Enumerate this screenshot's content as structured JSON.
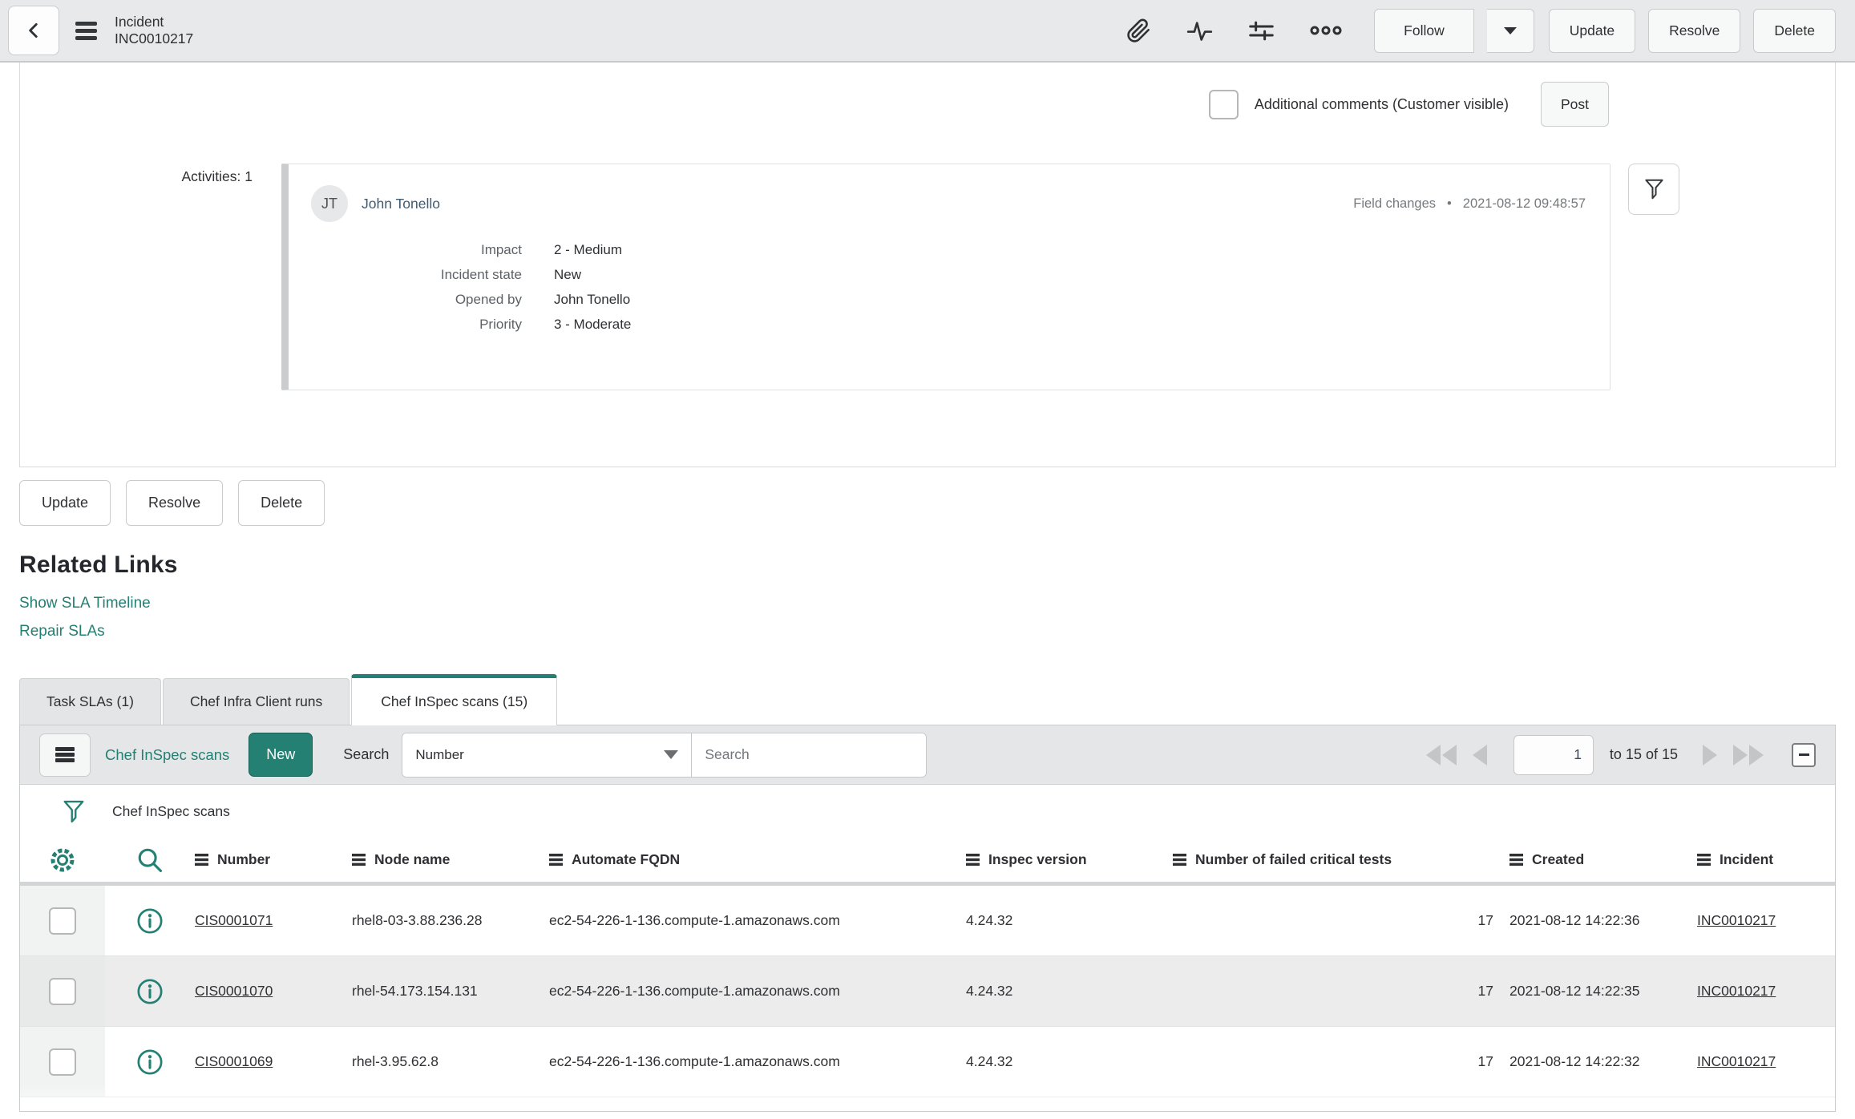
{
  "colors": {
    "accent": "#238073",
    "header_bg": "#e8e9eb",
    "stripe_row": "#ececed"
  },
  "header": {
    "title_line1": "Incident",
    "title_line2": "INC0010217",
    "follow": "Follow",
    "update": "Update",
    "resolve": "Resolve",
    "delete": "Delete"
  },
  "comments": {
    "label": "Additional comments (Customer visible)",
    "post": "Post"
  },
  "activities": {
    "count_label": "Activities: 1",
    "entry": {
      "avatar": "JT",
      "user": "John Tonello",
      "meta_type": "Field changes",
      "meta_separator": "•",
      "meta_time": "2021-08-12 09:48:57",
      "fields": [
        {
          "label": "Impact",
          "value": "2 - Medium"
        },
        {
          "label": "Incident state",
          "value": "New"
        },
        {
          "label": "Opened by",
          "value": "John Tonello"
        },
        {
          "label": "Priority",
          "value": "3 - Moderate"
        }
      ]
    }
  },
  "form_actions": {
    "update": "Update",
    "resolve": "Resolve",
    "delete": "Delete"
  },
  "related_links": {
    "title": "Related Links",
    "links": [
      "Show SLA Timeline",
      "Repair SLAs"
    ]
  },
  "tabs": [
    {
      "label": "Task SLAs (1)",
      "active": false
    },
    {
      "label": "Chef Infra Client runs",
      "active": false
    },
    {
      "label": "Chef InSpec scans (15)",
      "active": true
    }
  ],
  "list": {
    "title": "Chef InSpec scans",
    "new_button": "New",
    "search_label": "Search",
    "search_field": "Number",
    "search_placeholder": "Search",
    "pagination": {
      "page": "1",
      "range": "to 15 of 15"
    },
    "breadcrumb": "Chef InSpec scans",
    "columns": [
      "Number",
      "Node name",
      "Automate FQDN",
      "Inspec version",
      "Number of failed critical tests",
      "Created",
      "Incident"
    ],
    "rows": [
      {
        "number": "CIS0001071",
        "node_name": "rhel8-03-3.88.236.28",
        "automate_fqdn": "ec2-54-226-1-136.compute-1.amazonaws.com",
        "inspec_version": "4.24.32",
        "failed_critical_tests": "17",
        "created": "2021-08-12 14:22:36",
        "incident": "INC0010217"
      },
      {
        "number": "CIS0001070",
        "node_name": "rhel-54.173.154.131",
        "automate_fqdn": "ec2-54-226-1-136.compute-1.amazonaws.com",
        "inspec_version": "4.24.32",
        "failed_critical_tests": "17",
        "created": "2021-08-12 14:22:35",
        "incident": "INC0010217"
      },
      {
        "number": "CIS0001069",
        "node_name": "rhel-3.95.62.8",
        "automate_fqdn": "ec2-54-226-1-136.compute-1.amazonaws.com",
        "inspec_version": "4.24.32",
        "failed_critical_tests": "17",
        "created": "2021-08-12 14:22:32",
        "incident": "INC0010217"
      }
    ]
  }
}
